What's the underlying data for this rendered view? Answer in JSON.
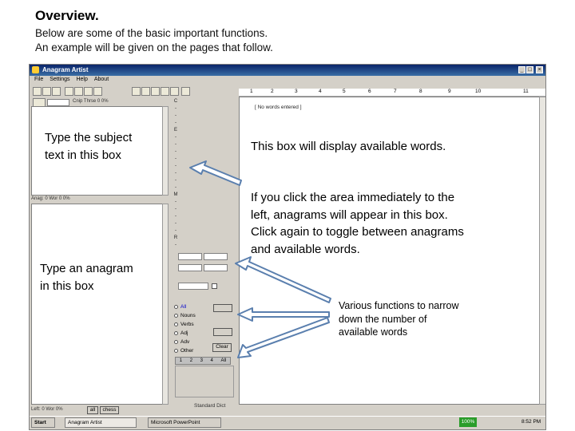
{
  "slide": {
    "title": "Overview.",
    "intro_line1": "Below are some of the basic important functions.",
    "intro_line2": "An example will be given on the pages that follow."
  },
  "window": {
    "title": "Anagram Artist",
    "menu": [
      "File",
      "Settings",
      "Help",
      "About"
    ],
    "subject_stat": "Cnip Thrse 0 0%",
    "anagram_stat": "Anag: 0 Wor 0 0%",
    "ruler": [
      "1",
      "2",
      "3",
      "4",
      "5",
      "6",
      "7",
      "8",
      "9",
      "10",
      "11"
    ],
    "words_header": "[ No words entered ]",
    "radio_options": [
      "All",
      "Nouns",
      "Verbs",
      "Adj",
      "Adv",
      "Other"
    ],
    "clear_button": "Clear",
    "num_tabs": [
      "1",
      "2",
      "3",
      "4",
      "All"
    ],
    "bottom_left_stat": "Left: 0 Wor 0%",
    "bottom_btn_all": "all",
    "bottom_btn_chess": "chess",
    "standard_dict": "Standard Dict",
    "minimize": "_",
    "maximize": "□",
    "close": "×"
  },
  "taskbar": {
    "start": "Start",
    "task1": "Anagram Artist",
    "task2": "Microsoft PowerPoint",
    "zoom": "100%",
    "time": "8:52 PM"
  },
  "callouts": {
    "subject_l1": "Type the subject",
    "subject_l2": "text in this box",
    "words_box": "This box will display available words.",
    "toggle_l1": "If you click the area immediately to the",
    "toggle_l2": "left, anagrams will appear in this box.",
    "toggle_l3": "Click again to toggle between anagrams",
    "toggle_l4": "and available words.",
    "anagram_l1": "Type an anagram",
    "anagram_l2": "in this box",
    "functions_l1": "Various functions to narrow",
    "functions_l2": "down  the number of",
    "functions_l3": "available words"
  },
  "colors": {
    "titlebar": "#0a246a",
    "window_face": "#d4d0c8",
    "arrow_fill": "#ffffff",
    "arrow_stroke": "#5a7fae"
  }
}
